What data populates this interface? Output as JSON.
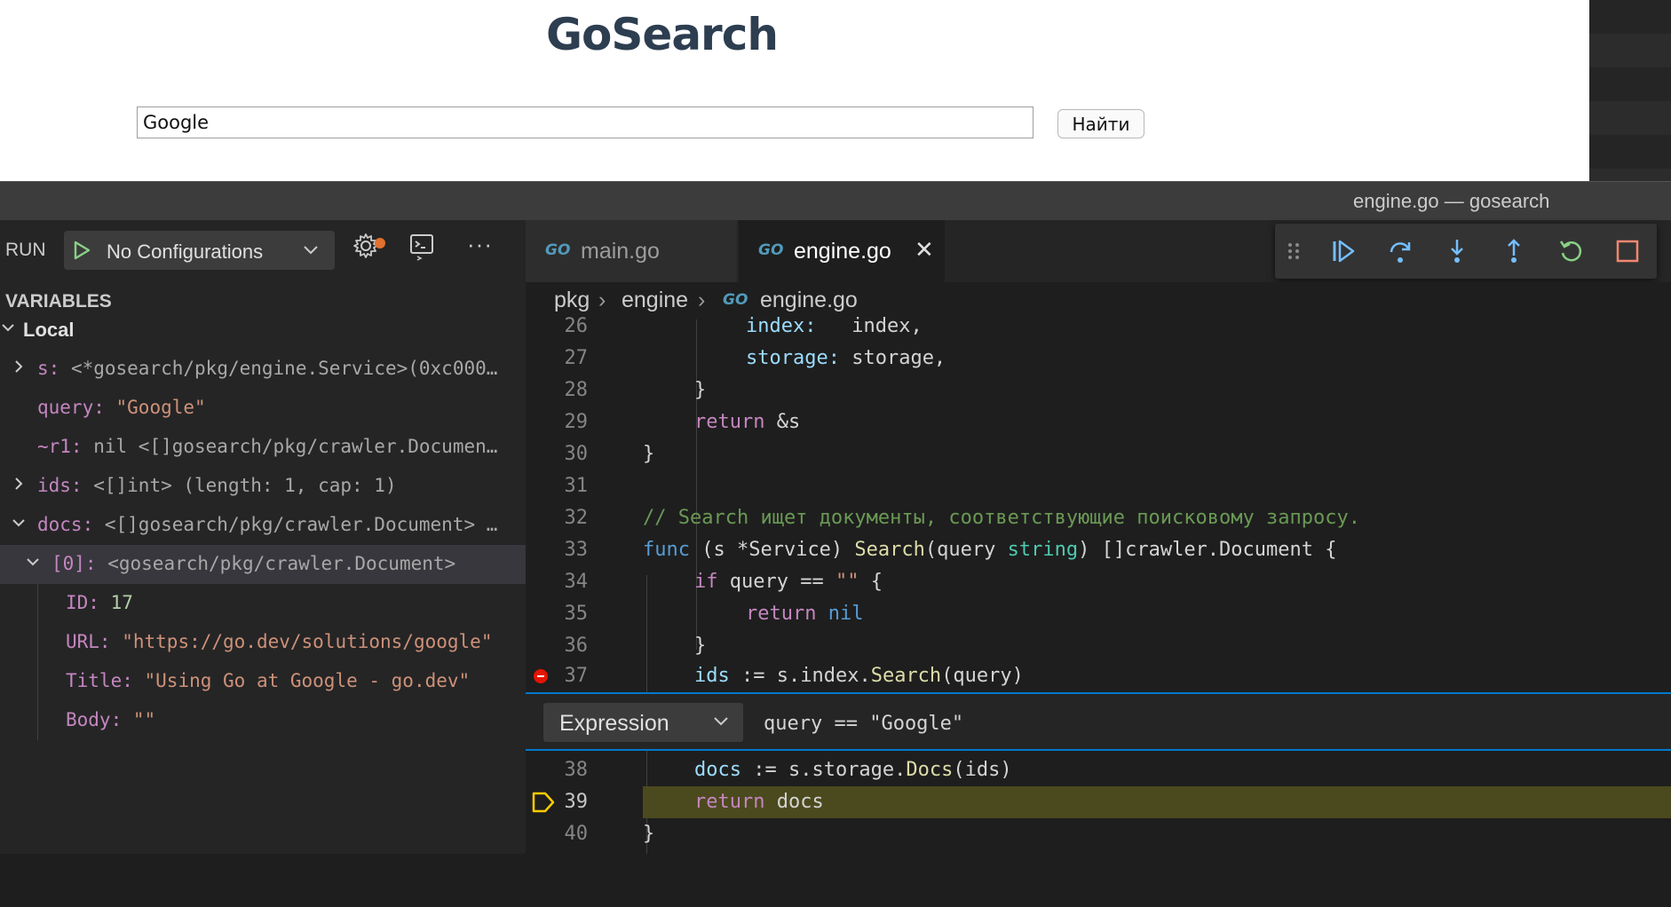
{
  "browser": {
    "app_title": "GoSearch",
    "search_value": "Google",
    "search_placeholder": "",
    "search_button": "Найти"
  },
  "window": {
    "title": "engine.go — gosearch"
  },
  "sidebar": {
    "run_label": "RUN",
    "config": "No Configurations",
    "variables_header": "VARIABLES",
    "scope": "Local",
    "vars": [
      {
        "key": "s:",
        "value": "<*gosearch/pkg/engine.Service>(0xc000…",
        "kind": "type"
      },
      {
        "key": "query:",
        "value": "\"Google\"",
        "kind": "str"
      },
      {
        "key": "~r1:",
        "value": "nil <[]gosearch/pkg/crawler.Documen…",
        "kind": "type"
      },
      {
        "key": "ids:",
        "value": "<[]int> (length: 1, cap: 1)",
        "kind": "type"
      },
      {
        "key": "docs:",
        "value": "<[]gosearch/pkg/crawler.Document> …",
        "kind": "type"
      },
      {
        "key": "[0]:",
        "value": "<gosearch/pkg/crawler.Document>",
        "kind": "type"
      },
      {
        "key": "ID:",
        "value": "17",
        "kind": "num"
      },
      {
        "key": "URL:",
        "value": "\"https://go.dev/solutions/google\"",
        "kind": "str"
      },
      {
        "key": "Title:",
        "value": "\"Using Go at Google - go.dev\"",
        "kind": "str"
      },
      {
        "key": "Body:",
        "value": "\"\"",
        "kind": "str"
      }
    ]
  },
  "editor": {
    "tabs": [
      {
        "icon": "GO",
        "label": "main.go"
      },
      {
        "icon": "GO",
        "label": "engine.go"
      }
    ],
    "breadcrumb": [
      "pkg",
      "engine",
      "engine.go"
    ],
    "lines": {
      "n26": "26",
      "n27": "27",
      "n28": "28",
      "n29": "29",
      "n30": "30",
      "n31": "31",
      "n32": "32",
      "n33": "33",
      "n34": "34",
      "n35": "35",
      "n36": "36",
      "n37": "37",
      "n38": "38",
      "n39": "39",
      "n40": "40"
    },
    "code": {
      "l26a": "index:",
      "l26b": "index,",
      "l27a": "storage:",
      "l27b": "storage,",
      "l28": "}",
      "l29a": "return",
      "l29b": "&s",
      "l30": "}",
      "l32": "// Search ищет документы, соответствующие поисковому запросу.",
      "l33_func": "func",
      "l33_recv": "(s *Service) ",
      "l33_name": "Search",
      "l33_p1": "(query ",
      "l33_type": "string",
      "l33_p2": ") []crawler.Document {",
      "l34_if": "if",
      "l34_rest": " query == ",
      "l34_str": "\"\"",
      "l34_end": " {",
      "l35_ret": "return",
      "l35_nil": "nil",
      "l36": "}",
      "l37_id": "ids",
      "l37_mid": " := s.index.",
      "l37_fn": "Search",
      "l37_end": "(query)",
      "l38_id": "docs",
      "l38_mid": " := s.storage.",
      "l38_fn": "Docs",
      "l38_end": "(ids)",
      "l39_ret": "return",
      "l39_rest": " docs",
      "l40": "}"
    },
    "breakpoint": {
      "type": "Expression",
      "condition": "query == \"Google\""
    }
  },
  "colors": {
    "accent": "#007acc",
    "current_line": "#4b4a1e",
    "breakpoint": "#e51400",
    "debug_arrow": "#ffcc00"
  }
}
